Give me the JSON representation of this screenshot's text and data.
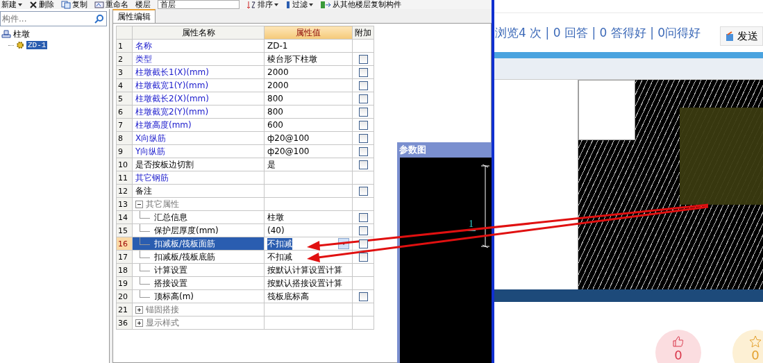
{
  "toolbar": [
    {
      "kind": "button",
      "label": "新建",
      "dropdown": true
    },
    {
      "kind": "button",
      "label": "删除",
      "dropdown": false
    },
    {
      "kind": "button",
      "label": "复制",
      "dropdown": false
    },
    {
      "kind": "button",
      "label": "重命名",
      "dropdown": false
    },
    {
      "kind": "label",
      "label": "楼层"
    },
    {
      "kind": "field",
      "value": "首层"
    },
    {
      "kind": "button",
      "label": "排序",
      "dropdown": true
    },
    {
      "kind": "button",
      "label": "过滤",
      "dropdown": true
    },
    {
      "kind": "button",
      "label": "从其他楼层复制构件",
      "dropdown": false
    }
  ],
  "search": {
    "placeholder": "构件..."
  },
  "tree": [
    {
      "label": "柱墩",
      "children": [
        {
          "label": "ZD-1",
          "selected": true
        }
      ]
    }
  ],
  "panel": {
    "tab": {
      "label": "属性编辑",
      "selected": true
    },
    "columns": [
      "属性名称",
      "属性值",
      "附加"
    ],
    "rows": [
      {
        "index": "1",
        "kind": "main",
        "name": "名称",
        "value": "ZD-1",
        "selected": false
      },
      {
        "index": "2",
        "kind": "main",
        "name": "类型",
        "value": "棱台形下柱墩",
        "checked": false,
        "selected": false
      },
      {
        "index": "3",
        "kind": "main",
        "name": "柱墩截长1(X)(mm)",
        "value": "2000",
        "checked": false,
        "selected": false
      },
      {
        "index": "4",
        "kind": "main",
        "name": "柱墩截宽1(Y)(mm)",
        "value": "2000",
        "checked": false,
        "selected": false
      },
      {
        "index": "5",
        "kind": "main",
        "name": "柱墩截长2(X)(mm)",
        "value": "800",
        "checked": false,
        "selected": false
      },
      {
        "index": "6",
        "kind": "main",
        "name": "柱墩截宽2(Y)(mm)",
        "value": "800",
        "checked": false,
        "selected": false
      },
      {
        "index": "7",
        "kind": "main",
        "name": "柱墩高度(mm)",
        "value": "600",
        "checked": false,
        "selected": false
      },
      {
        "index": "8",
        "kind": "main",
        "name": "X向纵筋",
        "value": "ф20@100",
        "checked": false,
        "selected": false
      },
      {
        "index": "9",
        "kind": "main",
        "name": "Y向纵筋",
        "value": "ф20@100",
        "checked": false,
        "selected": false
      },
      {
        "index": "10",
        "kind": "plain",
        "name": "是否按板边切割",
        "value": "是",
        "checked": false,
        "selected": false
      },
      {
        "index": "11",
        "kind": "main",
        "name": "其它钢筋",
        "selected": false
      },
      {
        "index": "12",
        "kind": "plain",
        "name": "备注",
        "checked": false,
        "selected": false
      },
      {
        "index": "13",
        "kind": "group",
        "name": "其它属性",
        "expanded": true,
        "selected": false,
        "children": [
          {
            "index": "14",
            "kind": "plain",
            "name": "汇总信息",
            "value": "柱墩",
            "checked": false,
            "selected": false
          },
          {
            "index": "15",
            "kind": "plain",
            "name": "保护层厚度(mm)",
            "value": "(40)",
            "checked": false,
            "selected": false
          },
          {
            "index": "16",
            "kind": "plain",
            "name": "扣减板/筏板面筋",
            "value": "不扣减",
            "checked": false,
            "selected": true
          },
          {
            "index": "17",
            "kind": "plain",
            "name": "扣减板/筏板底筋",
            "value": "不扣减",
            "checked": false,
            "selected": false
          },
          {
            "index": "18",
            "kind": "plain",
            "name": "计算设置",
            "value": "按默认计算设置计算",
            "selected": false
          },
          {
            "index": "19",
            "kind": "plain",
            "name": "搭接设置",
            "value": "按默认搭接设置计算",
            "selected": false
          },
          {
            "index": "20",
            "kind": "plain",
            "name": "顶标高(m)",
            "value": "筏板底标高",
            "checked": false,
            "selected": false
          }
        ]
      },
      {
        "index": "21",
        "kind": "group",
        "name": "锚固搭接",
        "expanded": false,
        "selected": false
      },
      {
        "index": "36",
        "kind": "group",
        "name": "显示样式",
        "expanded": false,
        "selected": false
      }
    ]
  },
  "figure_window": {
    "title": "参数图",
    "label": "1"
  },
  "web": {
    "stats": "浏览4 次 | 0 回答 | 0 答得好 | 0问得好",
    "send_button": "发送",
    "reactions": [
      {
        "kind": "like",
        "count": "0"
      },
      {
        "kind": "star",
        "count": "0"
      }
    ]
  }
}
